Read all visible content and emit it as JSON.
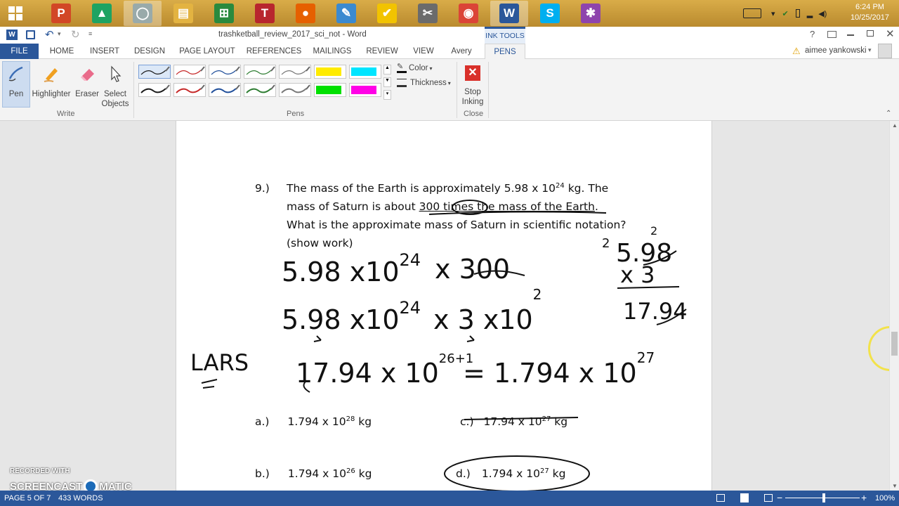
{
  "taskbar": {
    "apps": [
      {
        "name": "powerpoint",
        "letter": "P",
        "color": "#d24726"
      },
      {
        "name": "google-drive",
        "letter": "▲",
        "color": "#1ea362"
      },
      {
        "name": "cortana",
        "letter": "◯",
        "color": "#9aa"
      },
      {
        "name": "file-explorer",
        "letter": "▤",
        "color": "#e3b341"
      },
      {
        "name": "store",
        "letter": "⊞",
        "color": "#2a8a3e"
      },
      {
        "name": "t-app",
        "letter": "T",
        "color": "#b8262e"
      },
      {
        "name": "firefox",
        "letter": "●",
        "color": "#e66000"
      },
      {
        "name": "paint",
        "letter": "✎",
        "color": "#3b8ad0"
      },
      {
        "name": "tasks",
        "letter": "✔",
        "color": "#f2c300"
      },
      {
        "name": "tools",
        "letter": "✂",
        "color": "#6b6b6b"
      },
      {
        "name": "chrome",
        "letter": "◉",
        "color": "#db4437"
      },
      {
        "name": "word",
        "letter": "W",
        "color": "#2b579a"
      },
      {
        "name": "skype",
        "letter": "S",
        "color": "#00aff0"
      },
      {
        "name": "colorful-app",
        "letter": "✱",
        "color": "#8e44ad"
      }
    ],
    "time": "6:24 PM",
    "date": "10/25/2017"
  },
  "title": {
    "doc_title": "trashketball_review_2017_sci_not - Word",
    "context_tab": "INK TOOLS",
    "help": "?"
  },
  "tabs": [
    "FILE",
    "HOME",
    "INSERT",
    "DESIGN",
    "PAGE LAYOUT",
    "REFERENCES",
    "MAILINGS",
    "REVIEW",
    "VIEW",
    "Avery",
    "PENS"
  ],
  "user": {
    "name": "aimee yankowski"
  },
  "ribbon": {
    "write": {
      "pen": "Pen",
      "highlighter": "Highlighter",
      "eraser": "Eraser",
      "select1": "Select",
      "select2": "Objects",
      "label": "Write"
    },
    "pens_label": "Pens",
    "pen_colors_row1": [
      "#1a1a1a",
      "#c62828",
      "#1f4e9a",
      "#2e7d32",
      "#777777",
      "#ffeb00",
      "#00e5ff"
    ],
    "pen_colors_row2": [
      "#1a1a1a",
      "#c62828",
      "#1f4e9a",
      "#2e7d32",
      "#777777",
      "#00e000",
      "#ff00e6"
    ],
    "color": "Color",
    "thickness": "Thickness",
    "stop1": "Stop",
    "stop2": "Inking",
    "close_label": "Close"
  },
  "question": {
    "number": "9.)",
    "line1_a": "The mass of the Earth is approximately 5.98 x 10",
    "line1_sup": "24",
    "line1_b": " kg.  The",
    "line2_a": "mass of Saturn is about ",
    "line2_b": "300 times the mass of the Earth",
    "line2_c": ".",
    "line3": "What is the approximate mass of Saturn in scientific notation?",
    "line4": "(show work)"
  },
  "answers": [
    {
      "label": "a.)",
      "base": "1.794 x 10",
      "exp": "28",
      "unit": " kg"
    },
    {
      "label": "c.)",
      "base": "17.94 x 10",
      "exp": "27",
      "unit": " kg"
    },
    {
      "label": "b.)",
      "base": "1.794 x 10",
      "exp": "26",
      "unit": " kg"
    },
    {
      "label": "d.)",
      "base": "1.794 x 10",
      "exp": "27",
      "unit": " kg"
    }
  ],
  "handwriting": {
    "l1_a": "5.98 x10",
    "l1_exp": "24",
    "l1_b": "x 300",
    "l2_a": "5.98 x10",
    "l2_exp": "24",
    "l2_b": "x 3 x10",
    "l2_exp2": "2",
    "lars": "LARS",
    "l3_a": "17.94  x 10",
    "l3_exp": "26+1",
    "l3_b": "=  1.794 x 10",
    "l3_exp2": "27",
    "calc1": "5.98",
    "calc2": "x 3",
    "calc3": "17.94",
    "carry": "2"
  },
  "status": {
    "page": "PAGE 5 OF 7",
    "words": "433 WORDS",
    "zoom": "100%"
  },
  "watermark": {
    "top": "RECORDED WITH",
    "bottom": "SCREENCAST",
    "bottom2": "MATIC"
  }
}
